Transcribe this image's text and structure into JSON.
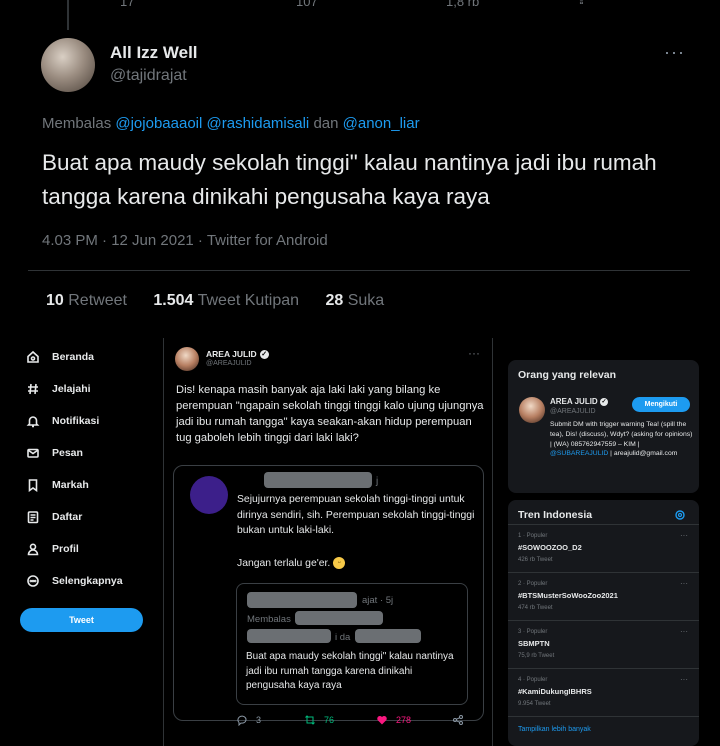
{
  "top_tweet": {
    "prev_actions": [
      "17",
      "107",
      "1,8 rb"
    ],
    "author_name": "All Izz Well",
    "author_handle": "@tajidrajat",
    "more": "···",
    "replying_prefix": "Membalas",
    "replying_to": [
      "@jojobaaaoil",
      "@rashidamisali",
      "@anon_liar"
    ],
    "replying_joiner": "dan",
    "text": "Buat apa maudy sekolah tinggi\" kalau nantinya jadi ibu rumah tangga karena dinikahi pengusaha kaya raya",
    "meta": "4.03 PM · 12 Jun 2021 · Twitter for Android",
    "stats": [
      {
        "value": "10",
        "label": "Retweet"
      },
      {
        "value": "1.504",
        "label": "Tweet Kutipan"
      },
      {
        "value": "28",
        "label": "Suka"
      }
    ]
  },
  "sidebar": {
    "items": [
      {
        "label": "Beranda",
        "icon": "home-icon"
      },
      {
        "label": "Jelajahi",
        "icon": "hashtag-icon"
      },
      {
        "label": "Notifikasi",
        "icon": "bell-icon"
      },
      {
        "label": "Pesan",
        "icon": "envelope-icon"
      },
      {
        "label": "Markah",
        "icon": "bookmark-icon"
      },
      {
        "label": "Daftar",
        "icon": "list-icon"
      },
      {
        "label": "Profil",
        "icon": "person-icon"
      },
      {
        "label": "Selengkapnya",
        "icon": "more-circle-icon"
      }
    ],
    "tweet_button": "Tweet"
  },
  "main_tweet": {
    "author_name": "AREA JULID",
    "author_handle": "@AREAJULID",
    "more": "···",
    "text": "Dis! kenapa masih banyak aja laki laki yang bilang ke perempuan \"ngapain sekolah tinggi tinggi kalo ujung ujungnya jadi ibu rumah tangga\" kaya seakan-akan hidup perempuan tug gaboleh lebih tinggi dari laki laki?",
    "quote": {
      "name_suffix": "j",
      "text": "Sejujurnya perempuan sekolah tinggi-tinggi untuk dirinya sendiri, sih. Perempuan sekolah tinggi-tinggi bukan untuk laki-laki.",
      "text2": "Jangan terlalu ge'er.",
      "emoji": "😁",
      "inner": {
        "time": "ajat · 5j",
        "membalas": "Membalas",
        "ida": "i da",
        "text": "Buat apa maudy sekolah tinggi\" kalau nantinya jadi ibu rumah tangga karena dinikahi pengusaha kaya raya"
      },
      "actions": {
        "reply": "3",
        "retweet": "76",
        "like": "278"
      }
    }
  },
  "relevant": {
    "title": "Orang yang relevan",
    "name": "AREA JULID",
    "handle": "@AREAJULID",
    "follow": "Mengikuti",
    "bio": "Submit DM with trigger warning Tea! (spill the tea), Dis! (discuss), Wdyt? (asking for opinions) | (WA) 085762947559 – KIM |",
    "bio_link": "@SUBAREAJULID",
    "bio_end": "| areajulid@gmail.com"
  },
  "trends": {
    "title": "Tren Indonesia",
    "items": [
      {
        "meta": "1 · Populer",
        "name": "#SOWOOZOO_D2",
        "count": "426 rb Tweet"
      },
      {
        "meta": "2 · Populer",
        "name": "#BTSMusterSoWooZoo2021",
        "count": "474 rb Tweet"
      },
      {
        "meta": "3 · Populer",
        "name": "SBMPTN",
        "count": "75,9 rb Tweet"
      },
      {
        "meta": "4 · Populer",
        "name": "#KamiDukungIBHRS",
        "count": "9.954 Tweet"
      }
    ],
    "show_more": "Tampilkan lebih banyak"
  },
  "colors": {
    "accent": "#1d9bf0",
    "background": "#000000",
    "panel": "#16181c",
    "muted": "#71767b",
    "like": "#f91880",
    "retweet": "#00ba7c"
  }
}
